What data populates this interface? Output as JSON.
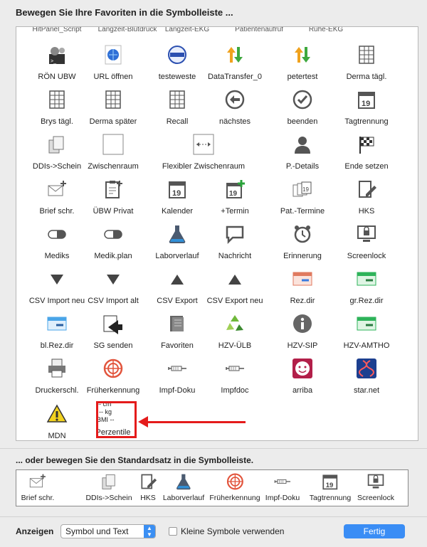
{
  "header": {
    "title": "Bewegen Sie Ihre Favoriten in die Symbolleiste ..."
  },
  "cut_row": [
    "HitPanel_Script",
    "Langzeit-Blutdruck",
    "Langzeit-EKG",
    "Patientenaufruf",
    "Ruhe-EKG"
  ],
  "grid": {
    "rows": [
      [
        {
          "label": "RÖN UBW",
          "icon": "gears-icon"
        },
        {
          "label": "URL öffnen",
          "icon": "globe-icon"
        },
        {
          "label": "testeweste",
          "icon": "seal-icon"
        },
        {
          "label": "DataTransfer_0",
          "icon": "arrows-updown-icon"
        },
        {
          "label": "petertest",
          "icon": "arrows-updown-icon"
        },
        {
          "label": "Derma tägl.",
          "icon": "table-icon"
        }
      ],
      [
        {
          "label": "Brys tägl.",
          "icon": "table-icon"
        },
        {
          "label": "Derma später",
          "icon": "table-icon"
        },
        {
          "label": "Recall",
          "icon": "table-icon"
        },
        {
          "label": "nächstes",
          "icon": "arrow-left-circle-icon"
        },
        {
          "label": "beenden",
          "icon": "checkmark-circle-icon"
        },
        {
          "label": "Tagtrennung",
          "icon": "calendar-icon"
        }
      ],
      [
        {
          "label": "DDIs->Schein",
          "icon": "documents-icon"
        },
        {
          "label": "Zwischenraum",
          "icon": "blank-space-icon"
        },
        {
          "label": "Flexibler Zwischenraum",
          "icon": "flexible-space-icon",
          "wide": true
        },
        {
          "label": "P.-Details",
          "icon": "person-icon"
        },
        {
          "label": "Ende setzen",
          "icon": "checkered-flag-icon"
        }
      ],
      [
        {
          "label": "Brief schr.",
          "icon": "envelope-plus-icon"
        },
        {
          "label": "ÜBW Privat",
          "icon": "clipboard-plus-icon"
        },
        {
          "label": "Kalender",
          "icon": "calendar-icon"
        },
        {
          "label": "+Termin",
          "icon": "calendar-plus-icon"
        },
        {
          "label": "Pat.-Termine",
          "icon": "calendar-stack-icon"
        },
        {
          "label": "HKS",
          "icon": "document-pencil-icon"
        }
      ],
      [
        {
          "label": "Mediks",
          "icon": "pill-icon"
        },
        {
          "label": "Medik.plan",
          "icon": "pill-icon"
        },
        {
          "label": "Laborverlauf",
          "icon": "lab-flask-icon"
        },
        {
          "label": "Nachricht",
          "icon": "speech-bubble-icon"
        },
        {
          "label": "Erinnerung",
          "icon": "alarm-clock-icon"
        },
        {
          "label": "Screenlock",
          "icon": "monitor-lock-icon"
        }
      ],
      [
        {
          "label": "CSV Import neu",
          "icon": "triangle-down-icon"
        },
        {
          "label": "CSV Import alt",
          "icon": "triangle-down-icon"
        },
        {
          "label": "CSV Export",
          "icon": "triangle-up-icon"
        },
        {
          "label": "CSV Export neu",
          "icon": "triangle-up-icon"
        },
        {
          "label": "Rez.dir",
          "icon": "prescription-red-icon"
        },
        {
          "label": "gr.Rez.dir",
          "icon": "prescription-green-icon"
        }
      ],
      [
        {
          "label": "bl.Rez.dir",
          "icon": "prescription-blue-icon"
        },
        {
          "label": "SG senden",
          "icon": "send-icon"
        },
        {
          "label": "Favoriten",
          "icon": "book-stack-icon"
        },
        {
          "label": "HZV-ÜLB",
          "icon": "recycle-icon"
        },
        {
          "label": "HZV-SIP",
          "icon": "info-circle-icon"
        },
        {
          "label": "HZV-AMTHO",
          "icon": "prescription-green-icon"
        }
      ],
      [
        {
          "label": "Druckerschl.",
          "icon": "printer-icon"
        },
        {
          "label": "Früherkennung",
          "icon": "target-icon"
        },
        {
          "label": "Impf-Doku",
          "icon": "syringe-icon"
        },
        {
          "label": "Impfdoc",
          "icon": "syringe-icon"
        },
        {
          "label": "arriba",
          "icon": "smiley-icon"
        },
        {
          "label": "star.net",
          "icon": "dna-icon"
        }
      ],
      [
        {
          "label": "MDN",
          "icon": "warning-icon"
        },
        {
          "label": "Perzentile",
          "icon": "measurements-icon",
          "lines": [
            "-- cm",
            "-- kg",
            "BMI --"
          ]
        }
      ]
    ]
  },
  "default_set": {
    "title": "... oder bewegen Sie den Standardsatz in die Symbolleiste.",
    "items": [
      {
        "label": "Brief schr.",
        "icon": "envelope-plus-icon"
      },
      {
        "label": "DDIs->Schein",
        "icon": "documents-icon"
      },
      {
        "label": "HKS",
        "icon": "document-pencil-icon"
      },
      {
        "label": "Laborverlauf",
        "icon": "lab-flask-icon"
      },
      {
        "label": "Früherkennung",
        "icon": "target-icon"
      },
      {
        "label": "Impf-Doku",
        "icon": "syringe-icon"
      },
      {
        "label": "Tagtrennung",
        "icon": "calendar-icon"
      },
      {
        "label": "Screenlock",
        "icon": "monitor-lock-icon"
      }
    ]
  },
  "footer": {
    "show_label": "Anzeigen",
    "show_value": "Symbol und Text",
    "small_icons_label": "Kleine Symbole verwenden",
    "small_icons_checked": false,
    "done_label": "Fertig"
  },
  "colors": {
    "accent": "#3a8df5",
    "highlight": "#e41b1b"
  }
}
